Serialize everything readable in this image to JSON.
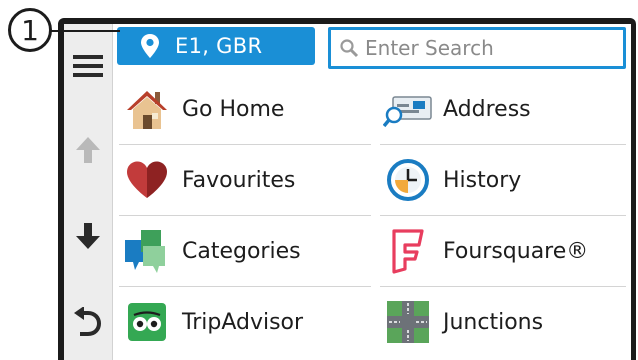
{
  "callout": {
    "label": "1"
  },
  "location_button": {
    "label": "E1, GBR"
  },
  "search": {
    "placeholder": "Enter Search"
  },
  "menu": {
    "left": [
      {
        "label": "Go Home",
        "icon": "house-icon"
      },
      {
        "label": "Favourites",
        "icon": "heart-icon"
      },
      {
        "label": "Categories",
        "icon": "categories-icon"
      },
      {
        "label": "TripAdvisor",
        "icon": "tripadvisor-icon"
      }
    ],
    "right": [
      {
        "label": "Address",
        "icon": "address-card-icon"
      },
      {
        "label": "History",
        "icon": "clock-icon"
      },
      {
        "label": "Foursquare®",
        "icon": "foursquare-icon"
      },
      {
        "label": "Junctions",
        "icon": "junction-icon"
      }
    ]
  },
  "sidebar": {
    "buttons": [
      "menu-icon",
      "arrow-up-icon",
      "arrow-down-icon",
      "back-icon"
    ]
  },
  "colors": {
    "accent": "#1a8fd6",
    "bezel": "#1b1b1b",
    "sidebar_bg": "#ededed",
    "disabled_arrow": "#b9b9b9"
  }
}
